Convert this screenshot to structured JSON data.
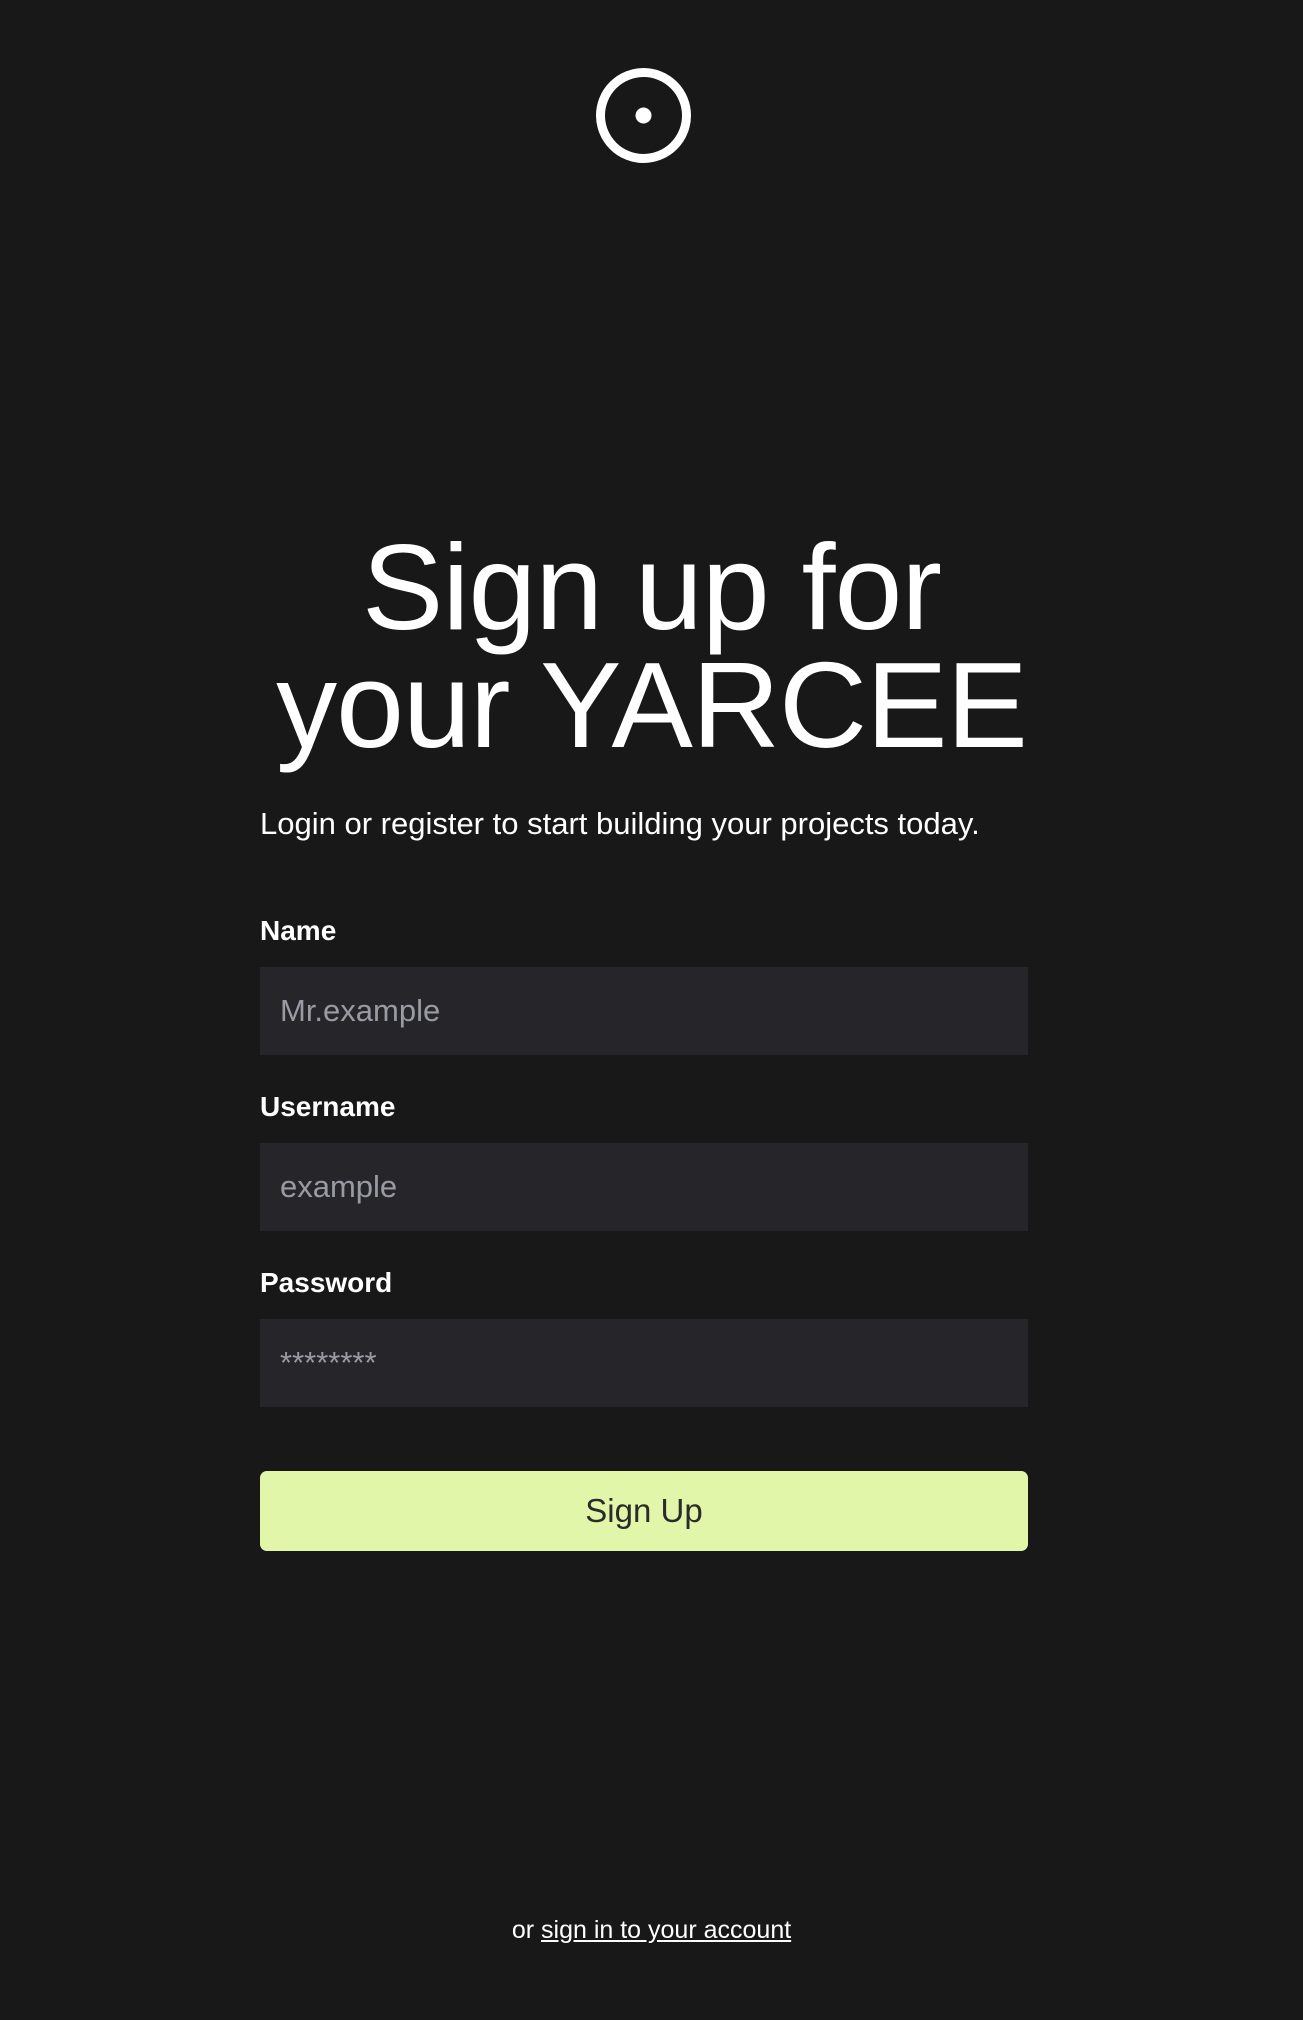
{
  "logo": {
    "icon": "circle-dot-icon",
    "color": "#ffffff"
  },
  "heading": {
    "line1": "Sign up for",
    "line2": "your YARCEE"
  },
  "subtitle": "Login or register to start building your projects today.",
  "form": {
    "name": {
      "label": "Name",
      "placeholder": "Mr.example"
    },
    "username": {
      "label": "Username",
      "placeholder": "example"
    },
    "password": {
      "label": "Password",
      "placeholder": "********"
    },
    "submit_label": "Sign Up"
  },
  "footer": {
    "prefix": "or",
    "link_text": "sign in to your account"
  },
  "colors": {
    "background": "#181818",
    "input_background": "#26262a",
    "button_accent": "#e1f6a8"
  }
}
